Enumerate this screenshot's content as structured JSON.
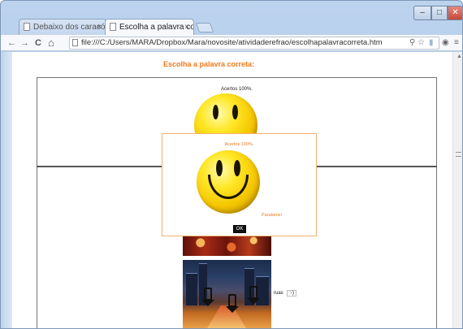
{
  "browser": {
    "tabs": [
      {
        "label": "Debaixo dos caracó",
        "active": false
      },
      {
        "label": "Escolha a palavra co",
        "active": true
      }
    ],
    "tab_close": "×",
    "window_controls": {
      "minimize": "–",
      "maximize": "□",
      "close": "✕"
    },
    "nav": {
      "back": "←",
      "forward": "→",
      "reload": "C",
      "home": "⌂"
    },
    "url": "file:///C:/Users/MARA/Dropbox/Mara/novosite/atividaderefrao/escolhapalavracorreta.htm",
    "toolbar_icons": [
      "search-icon",
      "star-icon",
      "signal-icon",
      "eye-icon",
      "menu-icon"
    ]
  },
  "page": {
    "title": "Escolha a palavra correta:",
    "background_hits": "Acertos 100%.",
    "ruas_word": "ruas",
    "ruas_box": ":-)"
  },
  "dialog": {
    "hits": "Acertos 100%.",
    "congrats": "Parabéns!",
    "ok_label": "OK"
  },
  "colors": {
    "accent": "#f07a1c",
    "dialog_border": "#f3b070"
  }
}
